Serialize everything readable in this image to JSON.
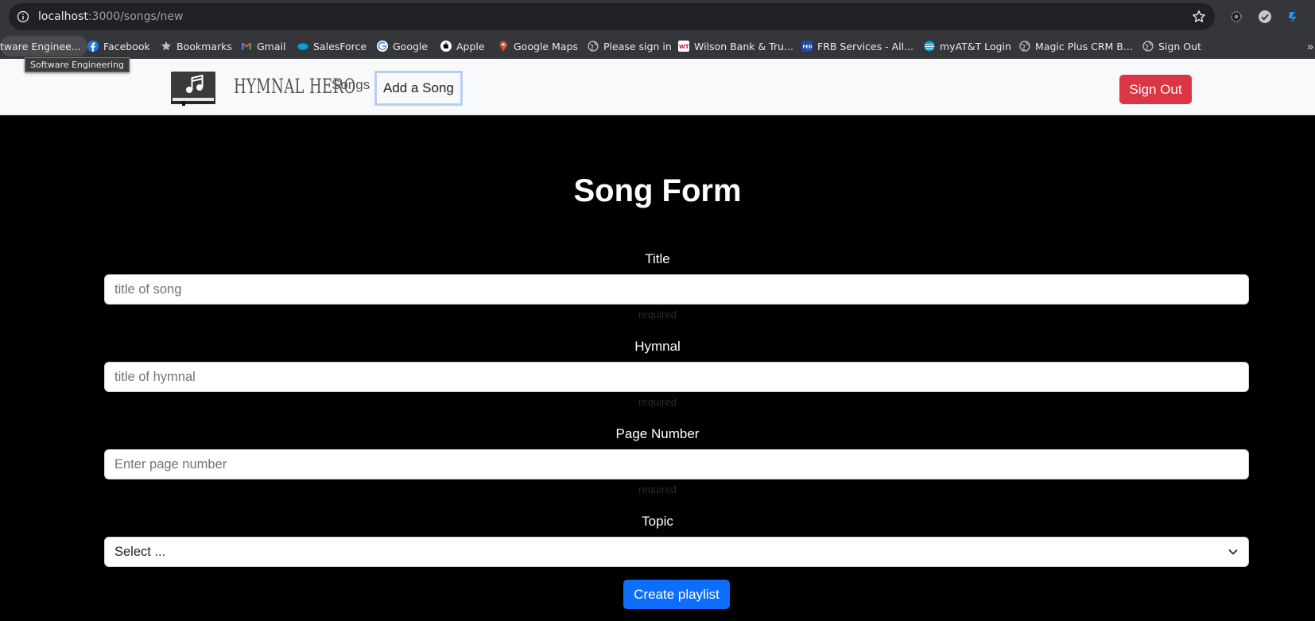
{
  "browser": {
    "url_host": "localhost",
    "url_path": ":3000/songs/new",
    "bookmarks": [
      {
        "label": "tware Enginee...",
        "icon": "folder-icon"
      },
      {
        "label": "Facebook",
        "icon": "facebook-icon"
      },
      {
        "label": "Bookmarks",
        "icon": "star-icon"
      },
      {
        "label": "Gmail",
        "icon": "gmail-icon"
      },
      {
        "label": "SalesForce",
        "icon": "salesforce-icon"
      },
      {
        "label": "Google",
        "icon": "google-icon"
      },
      {
        "label": "Apple",
        "icon": "apple-icon"
      },
      {
        "label": "Google Maps",
        "icon": "maps-icon"
      },
      {
        "label": "Please sign in",
        "icon": "globe-icon"
      },
      {
        "label": "Wilson Bank & Tru...",
        "icon": "wbt-icon"
      },
      {
        "label": "FRB Services - All...",
        "icon": "frb-icon"
      },
      {
        "label": "myAT&T Login",
        "icon": "att-icon"
      },
      {
        "label": "Magic Plus CRM B...",
        "icon": "globe-icon"
      },
      {
        "label": "Sign Out",
        "icon": "globe-icon"
      }
    ],
    "tooltip": "Software Engineering",
    "more_bookmarks": "»"
  },
  "nav": {
    "brand": "HYMNAL HERO",
    "songs": "Songs",
    "add_song": "Add a Song",
    "sign_out": "Sign Out"
  },
  "form": {
    "title": "Song Form",
    "fields": {
      "title": {
        "label": "Title",
        "placeholder": "title of song",
        "hint": "required"
      },
      "hymnal": {
        "label": "Hymnal",
        "placeholder": "title of hymnal",
        "hint": "required"
      },
      "page": {
        "label": "Page Number",
        "placeholder": "Enter page number",
        "hint": "required"
      },
      "topic": {
        "label": "Topic",
        "selected": "Select ..."
      }
    },
    "submit": "Create playlist"
  },
  "colors": {
    "danger": "#dc3545",
    "primary": "#0d6efd",
    "background": "#000000",
    "navbar": "#f8f9fa"
  }
}
